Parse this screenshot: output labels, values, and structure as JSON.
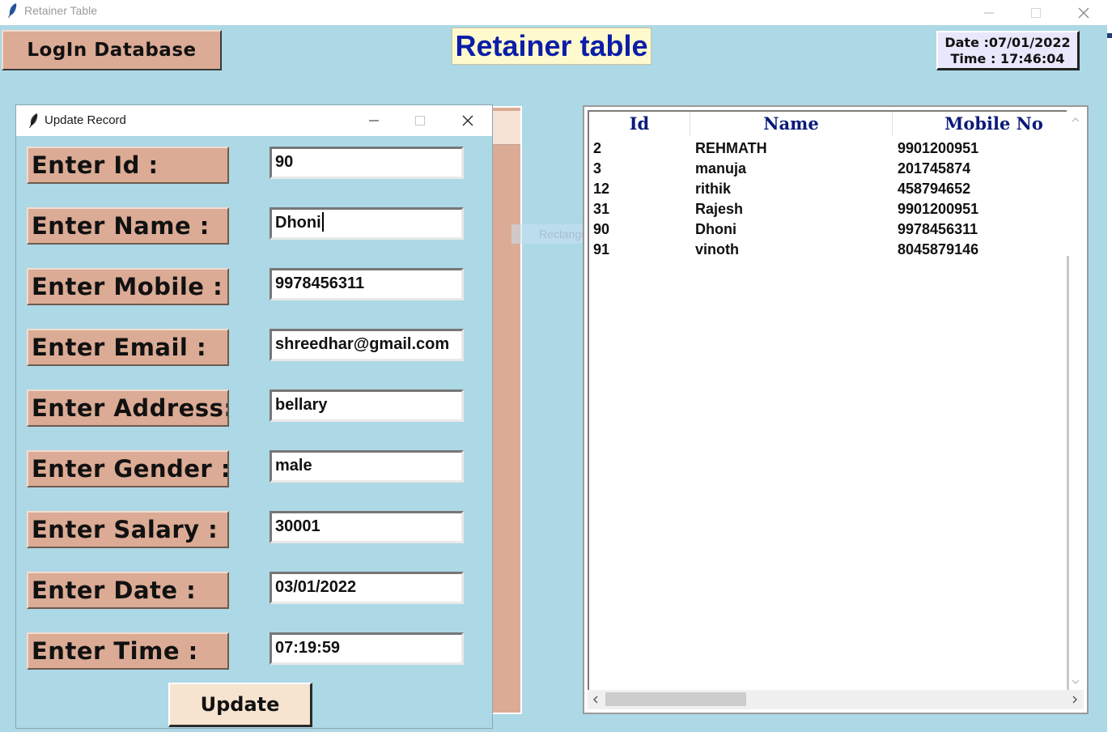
{
  "window": {
    "title": "Retainer Table"
  },
  "toolbar": {
    "login_label": "LogIn Database"
  },
  "header": {
    "title": "Retainer table",
    "date_line": "Date :07/01/2022",
    "time_line": "Time : 17:46:04"
  },
  "ghost_tooltip": "Rectangular Snip",
  "dialog": {
    "title": "Update Record",
    "fields": [
      {
        "label": "Enter Id :",
        "value": "90"
      },
      {
        "label": "Enter Name :",
        "value": "Dhoni"
      },
      {
        "label": "Enter Mobile :",
        "value": "9978456311"
      },
      {
        "label": "Enter Email :",
        "value": "shreedhar@gmail.com"
      },
      {
        "label": "Enter Address:",
        "value": "bellary"
      },
      {
        "label": "Enter Gender :",
        "value": "male"
      },
      {
        "label": "Enter Salary :",
        "value": "30001"
      },
      {
        "label": "Enter Date :",
        "value": "03/01/2022"
      },
      {
        "label": "Enter Time :",
        "value": "07:19:59"
      }
    ],
    "update_label": "Update"
  },
  "table": {
    "columns": [
      "Id",
      "Name",
      "Mobile No"
    ],
    "rows": [
      [
        "2",
        "REHMATH",
        "9901200951"
      ],
      [
        "3",
        "manuja",
        "201745874"
      ],
      [
        "12",
        "rithik",
        "458794652"
      ],
      [
        "31",
        "Rajesh",
        "9901200951"
      ],
      [
        "90",
        "Dhoni",
        "9978456311"
      ],
      [
        "91",
        "vinoth",
        "8045879146"
      ]
    ]
  },
  "icons": {
    "app": "feather-icon",
    "minimize": "minimize-icon",
    "maximize": "maximize-icon",
    "close": "close-icon"
  },
  "colors": {
    "background": "#add8e6",
    "label_bg": "#dbab95",
    "title_bg": "#fffacd",
    "title_text": "#0b1ea8",
    "header_text": "#0a1a7a"
  }
}
